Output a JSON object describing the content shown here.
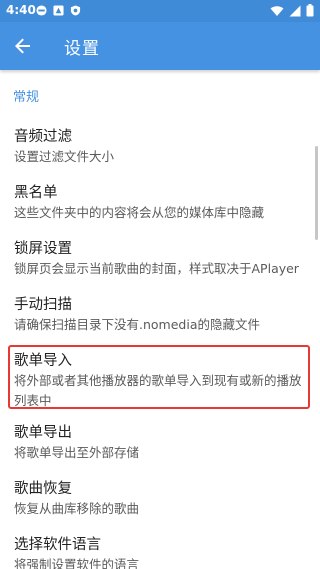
{
  "status_bar": {
    "time": "4:40"
  },
  "app_bar": {
    "title": "设置"
  },
  "section": {
    "header": "常规"
  },
  "items": [
    {
      "title": "音频过滤",
      "summary": "设置过滤文件大小"
    },
    {
      "title": "黑名单",
      "summary": "这些文件夹中的内容将会从您的媒体库中隐藏"
    },
    {
      "title": "锁屏设置",
      "summary": "锁屏页会显示当前歌曲的封面，样式取决于APlayer"
    },
    {
      "title": "手动扫描",
      "summary": "请确保扫描目录下没有.nomedia的隐藏文件"
    },
    {
      "title": "歌单导入",
      "summary": "将外部或者其他播放器的歌单导入到现有或新的播放列表中"
    },
    {
      "title": "歌单导出",
      "summary": "将歌单导出至外部存储"
    },
    {
      "title": "歌曲恢复",
      "summary": "恢复从曲库移除的歌曲"
    },
    {
      "title": "选择软件语言",
      "summary": "将强制设置软件的语言"
    }
  ],
  "colors": {
    "primary": "#4592e3",
    "status_bar": "#3f8bd8",
    "highlight": "#e53935"
  }
}
